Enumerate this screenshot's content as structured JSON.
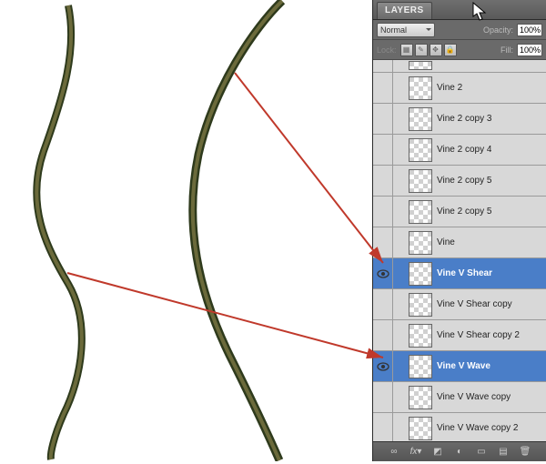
{
  "panel": {
    "title": "LAYERS",
    "blend_mode": "Normal",
    "opacity_label": "Opacity:",
    "opacity_value": "100%",
    "lock_label": "Lock:",
    "fill_label": "Fill:",
    "fill_value": "100%"
  },
  "layers": [
    {
      "name": "Vine 2",
      "visible": false,
      "selected": false
    },
    {
      "name": "Vine 2 copy 3",
      "visible": false,
      "selected": false
    },
    {
      "name": "Vine 2 copy 4",
      "visible": false,
      "selected": false
    },
    {
      "name": "Vine 2 copy 5",
      "visible": false,
      "selected": false
    },
    {
      "name": "Vine 2 copy 5",
      "visible": false,
      "selected": false
    },
    {
      "name": "Vine",
      "visible": false,
      "selected": false
    },
    {
      "name": "Vine V Shear",
      "visible": true,
      "selected": true
    },
    {
      "name": "Vine V Shear copy",
      "visible": false,
      "selected": false
    },
    {
      "name": "Vine V Shear copy 2",
      "visible": false,
      "selected": false
    },
    {
      "name": "Vine V Wave",
      "visible": true,
      "selected": true
    },
    {
      "name": "Vine V Wave copy",
      "visible": false,
      "selected": false
    },
    {
      "name": "Vine V Wave copy 2",
      "visible": false,
      "selected": false
    }
  ],
  "colors": {
    "panel_bg": "#535353",
    "row_bg": "#d8d8d8",
    "selected_bg": "#4a7ec8",
    "arrow": "#c0392b"
  },
  "icons": {
    "link": "link-icon",
    "fx": "fx-icon",
    "mask": "mask-icon",
    "adjustment": "adjustment-icon",
    "group": "group-icon",
    "new_layer": "new-layer-icon",
    "trash": "trash-icon"
  }
}
